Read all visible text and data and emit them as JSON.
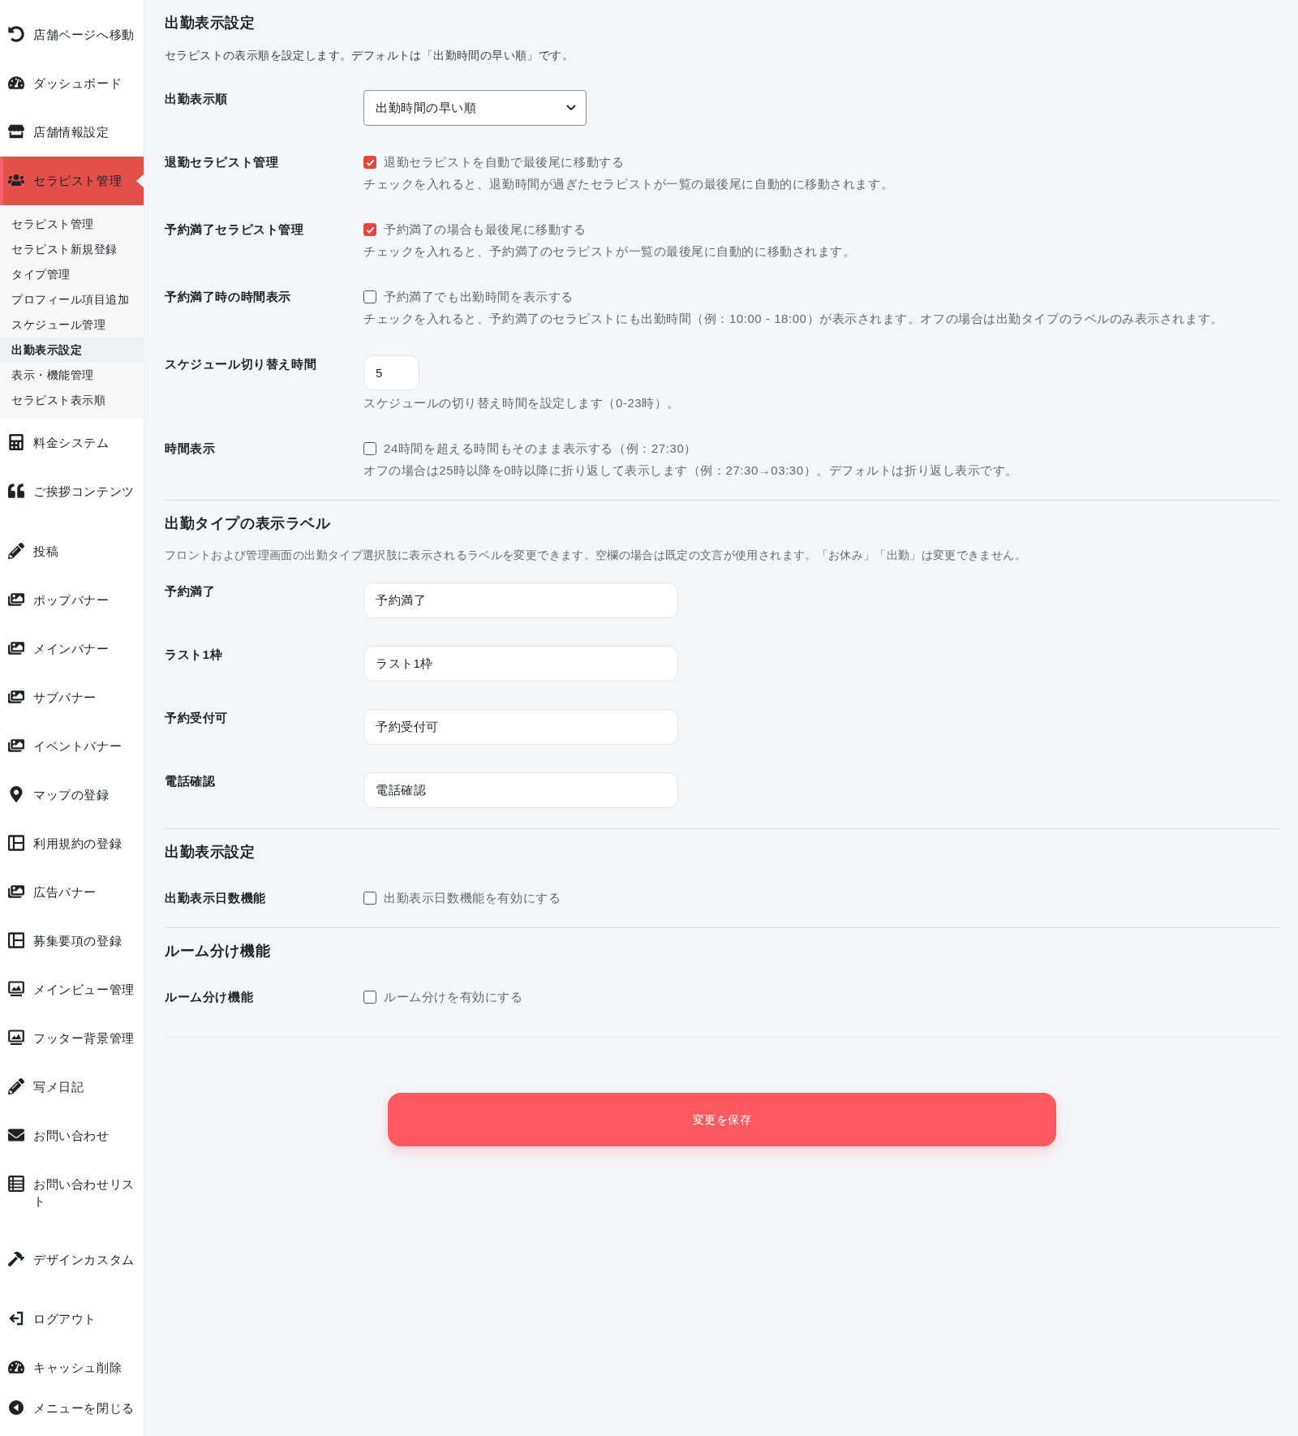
{
  "sidebar": {
    "items": [
      {
        "label": "店舗ページへ移動",
        "selected": false
      },
      {
        "label": "ダッシュボード",
        "selected": false
      },
      {
        "label": "店舗情報設定",
        "selected": false
      },
      {
        "label": "セラピスト管理",
        "selected": true,
        "children": [
          {
            "label": "セラピスト管理",
            "selected": false
          },
          {
            "label": "セラピスト新規登録",
            "selected": false
          },
          {
            "label": "タイプ管理",
            "selected": false
          },
          {
            "label": "プロフィール項目追加",
            "selected": false
          },
          {
            "label": "スケジュール管理",
            "selected": false
          },
          {
            "label": "出勤表示設定",
            "selected": true
          },
          {
            "label": "表示・機能管理",
            "selected": false
          },
          {
            "label": "セラピスト表示順",
            "selected": false
          }
        ]
      },
      {
        "label": "料金システム",
        "selected": false
      },
      {
        "label": "ご挨拶コンテンツ",
        "selected": false
      },
      {
        "label": "投稿",
        "selected": false
      },
      {
        "label": "ポップバナー",
        "selected": false
      },
      {
        "label": "メインバナー",
        "selected": false
      },
      {
        "label": "サブバナー",
        "selected": false
      },
      {
        "label": "イベントバナー",
        "selected": false
      },
      {
        "label": "マップの登録",
        "selected": false
      },
      {
        "label": "利用規約の登録",
        "selected": false
      },
      {
        "label": "広告バナー",
        "selected": false
      },
      {
        "label": "募集要項の登録",
        "selected": false
      },
      {
        "label": "メインビュー管理",
        "selected": false
      },
      {
        "label": "フッター背景管理",
        "selected": false
      },
      {
        "label": "写メ日記",
        "selected": false
      },
      {
        "label": "お問い合わせ",
        "selected": false
      },
      {
        "label": "お問い合わせリスト",
        "selected": false
      },
      {
        "label": "デザインカスタム",
        "selected": false
      },
      {
        "label": "ログアウト",
        "selected": false
      },
      {
        "label": "キャッシュ削除",
        "selected": false
      },
      {
        "label": "メニューを閉じる",
        "selected": false
      }
    ]
  },
  "sections": [
    {
      "title": "出勤表示設定",
      "description": "セラピストの表示順を設定します。デフォルトは「出勤時間の早い順」です。",
      "rows": [
        {
          "kind": "select",
          "label": "出勤表示順",
          "value": "出勤時間の早い順"
        },
        {
          "kind": "checkbox",
          "label": "退勤セラピスト管理",
          "option": "退勤セラピストを自動で最後尾に移動する",
          "checked": true,
          "help": "チェックを入れると、退勤時間が過ぎたセラピストが一覧の最後尾に自動的に移動されます。"
        },
        {
          "kind": "checkbox",
          "label": "予約満了セラピスト管理",
          "option": "予約満了の場合も最後尾に移動する",
          "checked": true,
          "help": "チェックを入れると、予約満了のセラピストが一覧の最後尾に自動的に移動されます。"
        },
        {
          "kind": "checkbox",
          "label": "予約満了時の時間表示",
          "option": "予約満了でも出勤時間を表示する",
          "checked": false,
          "help": "チェックを入れると、予約満了のセラピストにも出勤時間（例：10:00 - 18:00）が表示されます。オフの場合は出勤タイプのラベルのみ表示されます。"
        },
        {
          "kind": "number",
          "label": "スケジュール切り替え時間",
          "value": "5",
          "help": "スケジュールの切り替え時間を設定します（0-23時）。"
        },
        {
          "kind": "checkbox",
          "label": "時間表示",
          "option": "24時間を超える時間もそのまま表示する（例：27:30）",
          "checked": false,
          "help": "オフの場合は25時以降を0時以降に折り返して表示します（例：27:30→03:30）。デフォルトは折り返し表示です。"
        }
      ]
    },
    {
      "title": "出勤タイプの表示ラベル",
      "description": "フロントおよび管理画面の出勤タイプ選択肢に表示されるラベルを変更できます。空欄の場合は既定の文言が使用されます。「お休み」「出勤」は変更できません。",
      "rows": [
        {
          "kind": "text",
          "label": "予約満了",
          "value": "予約満了"
        },
        {
          "kind": "text",
          "label": "ラスト1枠",
          "value": "ラスト1枠"
        },
        {
          "kind": "text",
          "label": "予約受付可",
          "value": "予約受付可"
        },
        {
          "kind": "text",
          "label": "電話確認",
          "value": "電話確認"
        }
      ]
    },
    {
      "title": "出勤表示設定",
      "rows": [
        {
          "kind": "checkbox",
          "label": "出勤表示日数機能",
          "option": "出勤表示日数機能を有効にする",
          "checked": false
        }
      ]
    },
    {
      "title": "ルーム分け機能",
      "rows": [
        {
          "kind": "checkbox",
          "label": "ルーム分け機能",
          "option": "ルーム分けを有効にする",
          "checked": false
        }
      ]
    }
  ],
  "save_button": {
    "label": "変更を保存"
  }
}
